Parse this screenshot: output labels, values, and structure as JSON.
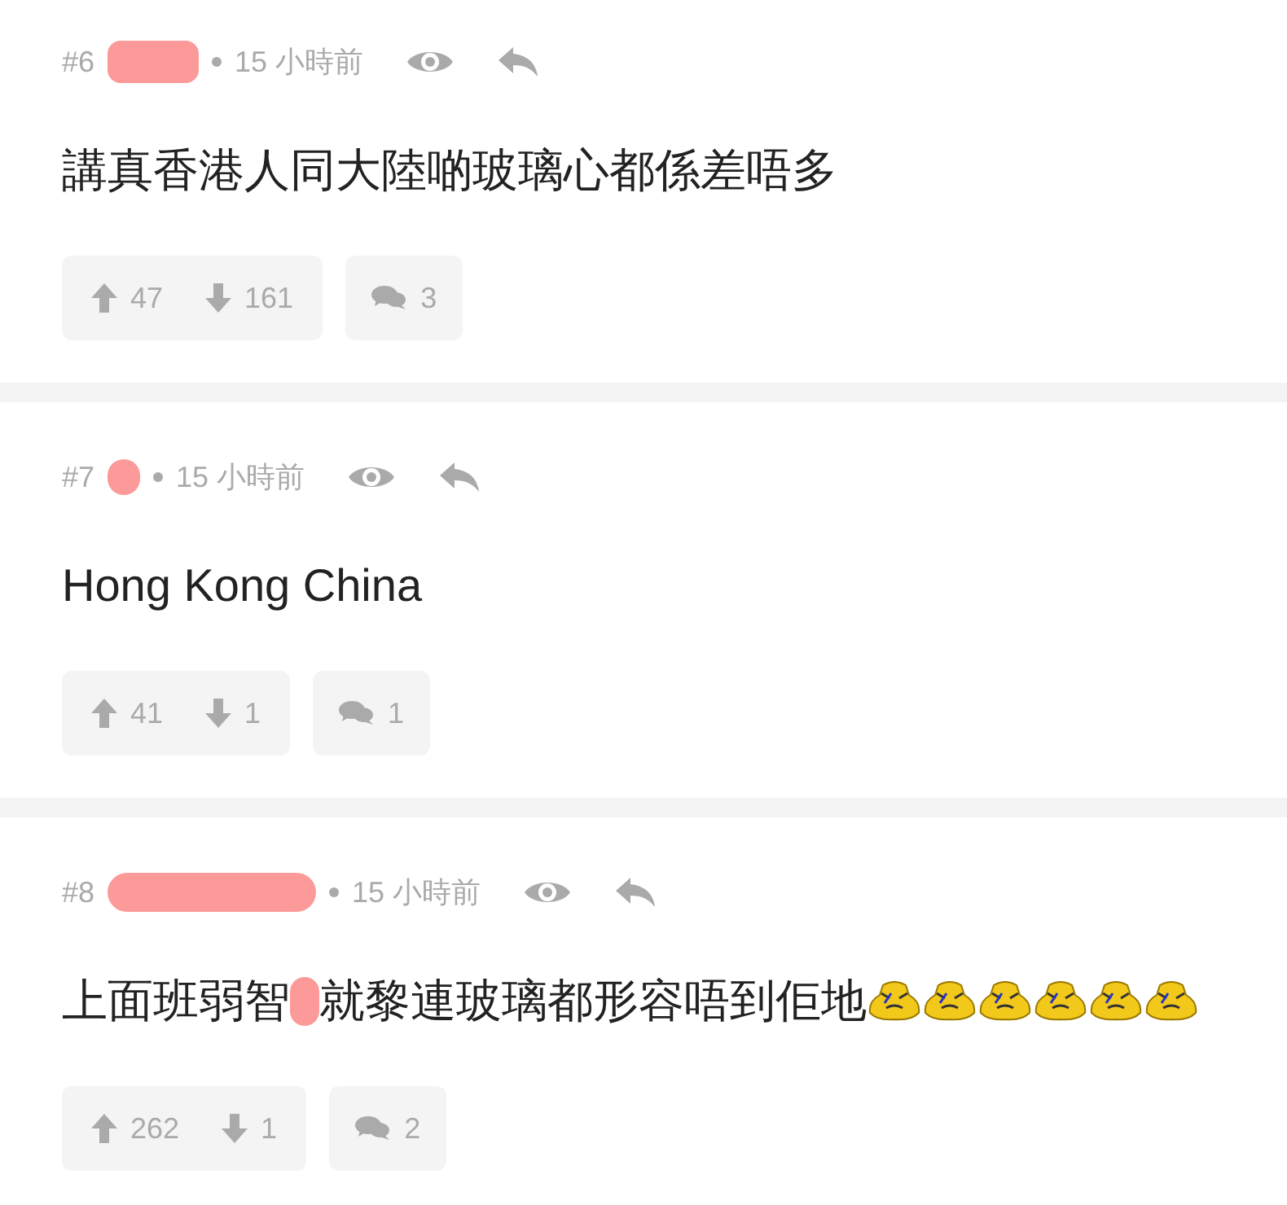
{
  "posts": [
    {
      "number": "#6",
      "author": {
        "redacted": true,
        "kind": "wide"
      },
      "time": "15 小時前",
      "body": [
        {
          "kind": "text",
          "text": "講真香港人同大陸啲玻璃心都係差唔多"
        }
      ],
      "upvotes": "47",
      "downvotes": "161",
      "replies": "3"
    },
    {
      "number": "#7",
      "author": {
        "redacted": true,
        "kind": "narrow"
      },
      "time": "15 小時前",
      "body": [
        {
          "kind": "text",
          "text": "Hong Kong China"
        }
      ],
      "upvotes": "41",
      "downvotes": "1",
      "replies": "1"
    },
    {
      "number": "#8",
      "author": {
        "redacted": true,
        "kind": "long"
      },
      "time": "15 小時前",
      "body": [
        {
          "kind": "text",
          "text": "上面班弱智"
        },
        {
          "kind": "redaction"
        },
        {
          "kind": "text",
          "text": "就黎連玻璃都形容唔到佢地"
        },
        {
          "kind": "emoticon"
        },
        {
          "kind": "emoticon"
        },
        {
          "kind": "emoticon"
        },
        {
          "kind": "emoticon"
        },
        {
          "kind": "emoticon"
        },
        {
          "kind": "emoticon"
        }
      ],
      "upvotes": "262",
      "downvotes": "1",
      "replies": "2"
    }
  ]
}
